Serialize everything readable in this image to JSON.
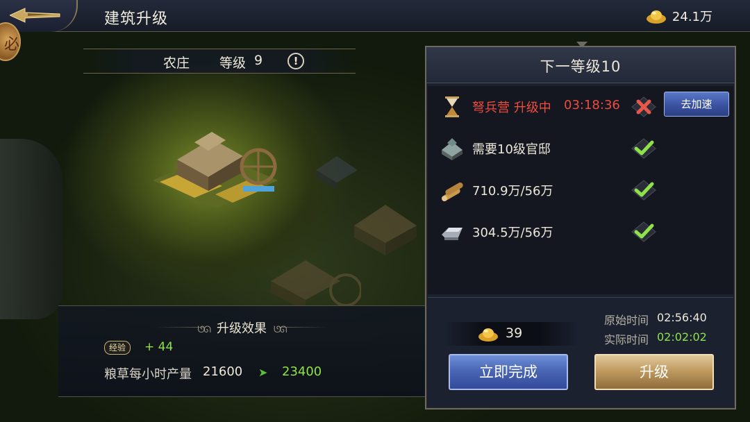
{
  "header": {
    "title": "建筑升级",
    "gold_amount": "24.1万"
  },
  "side_badge": {
    "label": "必"
  },
  "building": {
    "name": "农庄",
    "level_label": "等级",
    "level": "9"
  },
  "effects": {
    "title": "升级效果",
    "exp_label": "经验",
    "exp_value": "+ 44",
    "stat_label": "粮草每小时产量",
    "stat_current": "21600",
    "stat_next": "23400"
  },
  "next_level": {
    "title": "下一等级10",
    "requirements": [
      {
        "icon": "hourglass-icon",
        "text": "弩兵营 升级中",
        "timer": "03:18:36",
        "status": "failed",
        "action": "去加速"
      },
      {
        "icon": "government-building-icon",
        "text": "需要10级官邸",
        "status": "ok"
      },
      {
        "icon": "wood-logs-icon",
        "text": "710.9万/56万",
        "status": "ok"
      },
      {
        "icon": "iron-ingot-icon",
        "text": "304.5万/56万",
        "status": "ok"
      }
    ]
  },
  "cost": {
    "gold": "39"
  },
  "time": {
    "original_label": "原始时间",
    "original_value": "02:56:40",
    "actual_label": "实际时间",
    "actual_value": "02:02:02"
  },
  "buttons": {
    "complete_now": "立即完成",
    "upgrade": "升级"
  },
  "colors": {
    "status_ok": "#8fe24a",
    "status_fail": "#ef4b3e",
    "panel_bg": "#1c2130",
    "blue_button": "#4a67b5",
    "gold_button": "#c09c62"
  }
}
